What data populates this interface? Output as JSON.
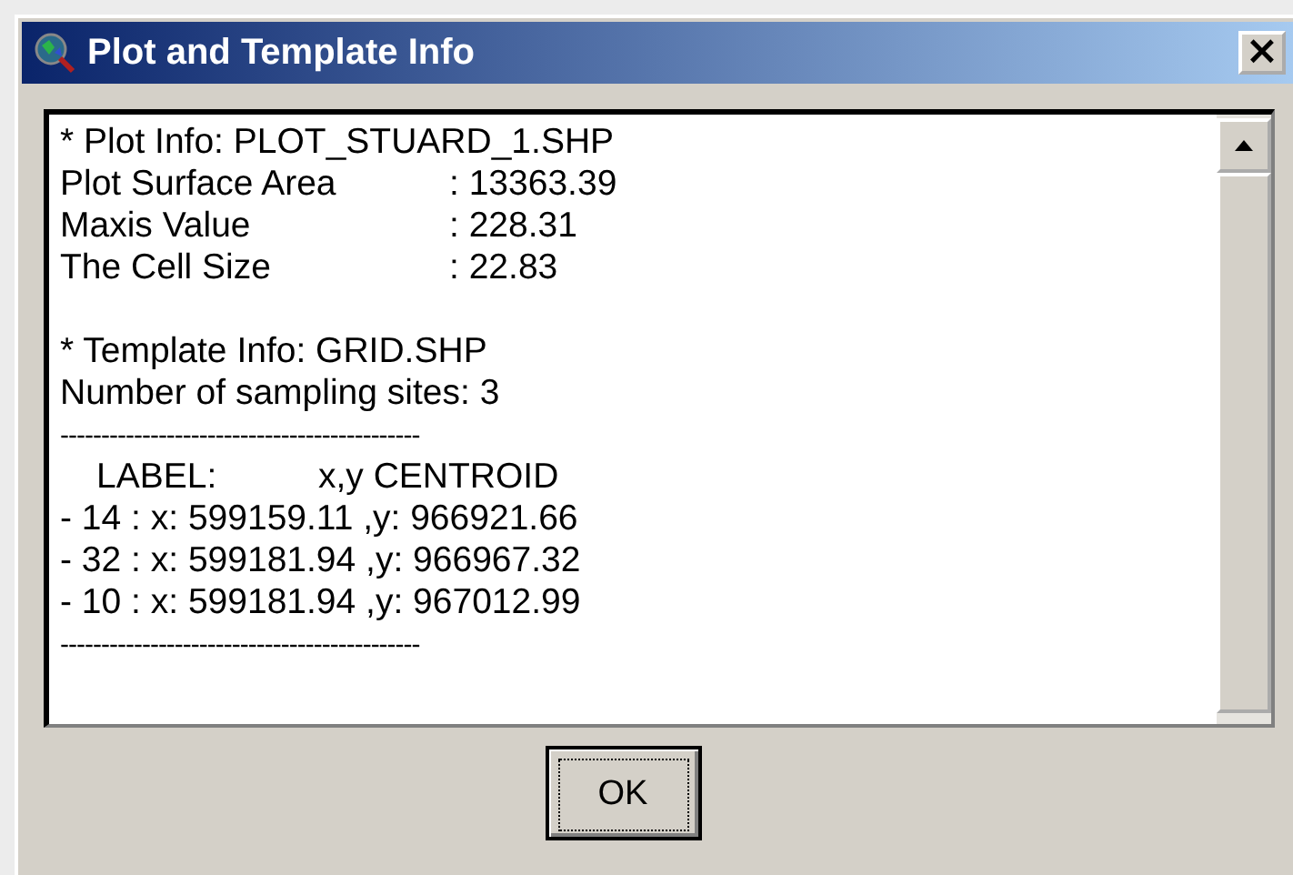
{
  "window": {
    "title": "Plot and Template Info",
    "close": "×"
  },
  "lines": [
    {
      "kind": "text",
      "text": "* Plot Info: PLOT_STUARD_1.SHP"
    },
    {
      "kind": "pair",
      "label": "Plot Surface Area",
      "value": ": 13363.39"
    },
    {
      "kind": "pair",
      "label": "Maxis Value",
      "value": ": 228.31"
    },
    {
      "kind": "pair",
      "label": "The Cell Size",
      "value": ": 22.83"
    },
    {
      "kind": "spacer"
    },
    {
      "kind": "text",
      "text": "* Template Info: GRID.SHP"
    },
    {
      "kind": "text",
      "text": "Number of sampling sites: 3"
    },
    {
      "kind": "rule",
      "text": "--------------------------------------------"
    },
    {
      "kind": "header",
      "label": "LABEL:",
      "value": "x,y CENTROID"
    },
    {
      "kind": "text",
      "text": "- 14 : x: 599159.11 ,y: 966921.66"
    },
    {
      "kind": "text",
      "text": "- 32 : x: 599181.94 ,y: 966967.32"
    },
    {
      "kind": "text",
      "text": "- 10 : x: 599181.94 ,y: 967012.99"
    },
    {
      "kind": "rule",
      "text": "--------------------------------------------"
    }
  ],
  "buttons": [
    "OK"
  ]
}
